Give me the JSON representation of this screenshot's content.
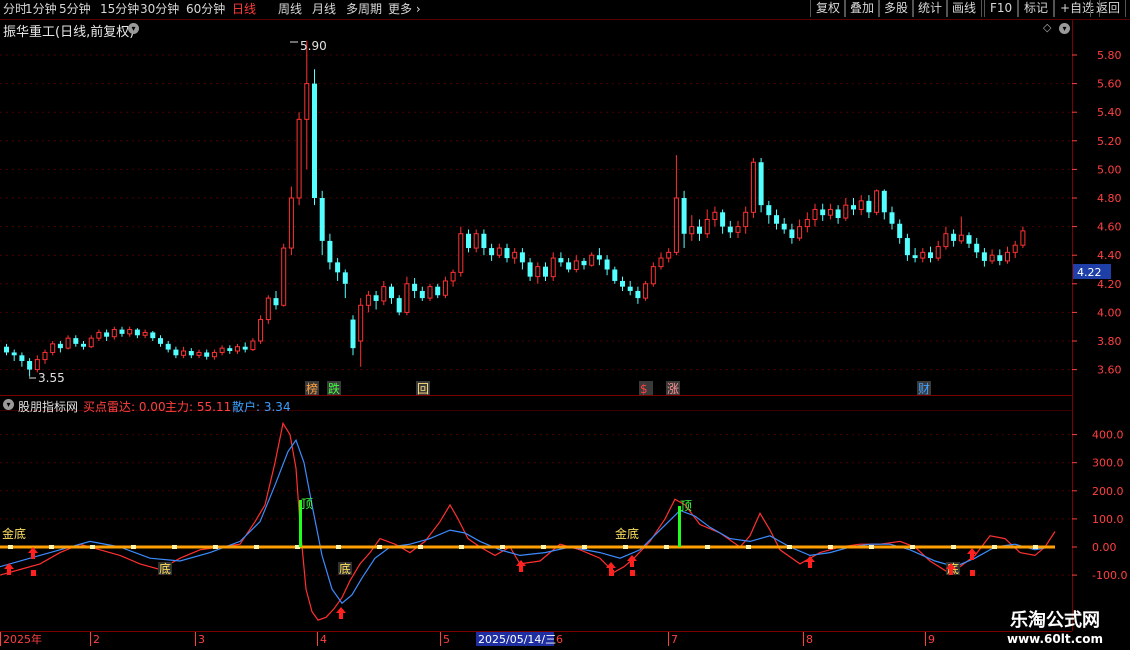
{
  "toolbar": {
    "periods": [
      "分时",
      "1分钟",
      "5分钟",
      "15分钟",
      "30分钟",
      "60分钟",
      "日线",
      "周线",
      "月线",
      "多周期",
      "更多"
    ],
    "active_period": "日线",
    "actions": [
      "复权",
      "叠加",
      "多股",
      "统计",
      "画线",
      "F10",
      "标记",
      "+自选",
      "返回"
    ]
  },
  "stock": {
    "title": "振华重工(日线,前复权)"
  },
  "indicator": {
    "name": "股朋指标网",
    "lines": [
      {
        "label": "买点雷达: 0.00",
        "color": "#ff4040"
      },
      {
        "label": "主力: 55.11",
        "color": "#ff4040"
      },
      {
        "label": "散户: 3.34",
        "color": "#3ca0ff"
      }
    ]
  },
  "price_axis": {
    "ticks": [
      "5.80",
      "5.60",
      "5.40",
      "5.20",
      "5.00",
      "4.80",
      "4.60",
      "4.40",
      "4.20",
      "4.00",
      "3.80",
      "3.60"
    ],
    "current": "4.22"
  },
  "ind_axis": {
    "ticks": [
      "400.0",
      "300.0",
      "200.0",
      "100.0",
      "0.00",
      "-100.0"
    ]
  },
  "annotations": {
    "high": "5.90",
    "low": "3.55",
    "events": [
      "榜",
      "跌",
      "回",
      "$",
      "涨",
      "财"
    ]
  },
  "ind_labels": {
    "jin_di": "金底",
    "di": "底",
    "ding": "顶"
  },
  "time_axis": {
    "labels": [
      "2025年",
      "2",
      "3",
      "4",
      "5",
      "6",
      "7",
      "8",
      "9"
    ],
    "cursor": "2025/05/14/三"
  },
  "watermark": {
    "title": "乐淘公式网",
    "url": "www.60lt.com"
  },
  "chart_data": {
    "type": "candlestick",
    "title": "振华重工(日线,前复权)",
    "ylim": [
      3.5,
      5.95
    ],
    "high_label": 5.9,
    "low_label": 3.55,
    "last_close": 4.22,
    "candles": [
      [
        3.76,
        3.72,
        3.78,
        3.7
      ],
      [
        3.72,
        3.7,
        3.74,
        3.66
      ],
      [
        3.7,
        3.66,
        3.72,
        3.62
      ],
      [
        3.66,
        3.6,
        3.68,
        3.55
      ],
      [
        3.6,
        3.67,
        3.7,
        3.58
      ],
      [
        3.67,
        3.72,
        3.74,
        3.64
      ],
      [
        3.72,
        3.78,
        3.8,
        3.7
      ],
      [
        3.78,
        3.75,
        3.8,
        3.72
      ],
      [
        3.75,
        3.82,
        3.84,
        3.74
      ],
      [
        3.82,
        3.78,
        3.84,
        3.76
      ],
      [
        3.78,
        3.76,
        3.8,
        3.74
      ],
      [
        3.76,
        3.82,
        3.84,
        3.75
      ],
      [
        3.82,
        3.86,
        3.88,
        3.8
      ],
      [
        3.86,
        3.83,
        3.88,
        3.8
      ],
      [
        3.83,
        3.88,
        3.9,
        3.81
      ],
      [
        3.88,
        3.85,
        3.9,
        3.83
      ],
      [
        3.85,
        3.88,
        3.9,
        3.83
      ],
      [
        3.88,
        3.84,
        3.89,
        3.82
      ],
      [
        3.84,
        3.86,
        3.88,
        3.82
      ],
      [
        3.86,
        3.82,
        3.87,
        3.8
      ],
      [
        3.82,
        3.78,
        3.84,
        3.76
      ],
      [
        3.78,
        3.74,
        3.8,
        3.72
      ],
      [
        3.74,
        3.7,
        3.76,
        3.68
      ],
      [
        3.7,
        3.73,
        3.76,
        3.68
      ],
      [
        3.73,
        3.7,
        3.75,
        3.68
      ],
      [
        3.7,
        3.72,
        3.74,
        3.68
      ],
      [
        3.72,
        3.69,
        3.74,
        3.67
      ],
      [
        3.69,
        3.72,
        3.74,
        3.67
      ],
      [
        3.72,
        3.75,
        3.77,
        3.7
      ],
      [
        3.75,
        3.73,
        3.77,
        3.71
      ],
      [
        3.73,
        3.76,
        3.78,
        3.71
      ],
      [
        3.76,
        3.74,
        3.79,
        3.72
      ],
      [
        3.74,
        3.8,
        3.82,
        3.73
      ],
      [
        3.8,
        3.95,
        3.98,
        3.78
      ],
      [
        3.95,
        4.1,
        4.12,
        3.92
      ],
      [
        4.1,
        4.05,
        4.15,
        4.02
      ],
      [
        4.05,
        4.45,
        4.48,
        4.04
      ],
      [
        4.45,
        4.8,
        4.88,
        4.4
      ],
      [
        4.8,
        5.35,
        5.4,
        4.75
      ],
      [
        5.35,
        5.6,
        5.9,
        5.0
      ],
      [
        5.6,
        4.8,
        5.7,
        4.75
      ],
      [
        4.8,
        4.5,
        4.85,
        4.4
      ],
      [
        4.5,
        4.35,
        4.55,
        4.3
      ],
      [
        4.35,
        4.28,
        4.38,
        4.22
      ],
      [
        4.28,
        4.2,
        4.3,
        4.1
      ],
      [
        3.95,
        3.75,
        3.98,
        3.7
      ],
      [
        3.8,
        4.05,
        4.1,
        3.62
      ],
      [
        4.05,
        4.12,
        4.15,
        4.0
      ],
      [
        4.12,
        4.08,
        4.15,
        4.02
      ],
      [
        4.08,
        4.18,
        4.22,
        4.05
      ],
      [
        4.18,
        4.1,
        4.2,
        4.06
      ],
      [
        4.1,
        4.0,
        4.12,
        3.98
      ],
      [
        4.0,
        4.2,
        4.25,
        3.98
      ],
      [
        4.2,
        4.15,
        4.24,
        4.1
      ],
      [
        4.15,
        4.1,
        4.18,
        4.08
      ],
      [
        4.1,
        4.18,
        4.2,
        4.08
      ],
      [
        4.18,
        4.12,
        4.2,
        4.1
      ],
      [
        4.12,
        4.22,
        4.25,
        4.1
      ],
      [
        4.22,
        4.28,
        4.3,
        4.18
      ],
      [
        4.28,
        4.55,
        4.6,
        4.25
      ],
      [
        4.55,
        4.45,
        4.58,
        4.42
      ],
      [
        4.45,
        4.55,
        4.58,
        4.42
      ],
      [
        4.55,
        4.45,
        4.58,
        4.4
      ],
      [
        4.45,
        4.4,
        4.48,
        4.36
      ],
      [
        4.4,
        4.45,
        4.48,
        4.38
      ],
      [
        4.45,
        4.38,
        4.48,
        4.35
      ],
      [
        4.38,
        4.42,
        4.45,
        4.34
      ],
      [
        4.42,
        4.35,
        4.45,
        4.3
      ],
      [
        4.35,
        4.25,
        4.38,
        4.22
      ],
      [
        4.25,
        4.32,
        4.35,
        4.2
      ],
      [
        4.32,
        4.25,
        4.35,
        4.22
      ],
      [
        4.25,
        4.38,
        4.42,
        4.22
      ],
      [
        4.38,
        4.35,
        4.42,
        4.32
      ],
      [
        4.35,
        4.3,
        4.38,
        4.28
      ],
      [
        4.3,
        4.36,
        4.4,
        4.28
      ],
      [
        4.36,
        4.33,
        4.38,
        4.3
      ],
      [
        4.33,
        4.4,
        4.42,
        4.32
      ],
      [
        4.4,
        4.37,
        4.45,
        4.33
      ],
      [
        4.37,
        4.3,
        4.4,
        4.26
      ],
      [
        4.3,
        4.22,
        4.32,
        4.2
      ],
      [
        4.22,
        4.18,
        4.25,
        4.15
      ],
      [
        4.18,
        4.15,
        4.22,
        4.12
      ],
      [
        4.15,
        4.1,
        4.18,
        4.06
      ],
      [
        4.1,
        4.2,
        4.22,
        4.08
      ],
      [
        4.2,
        4.32,
        4.35,
        4.18
      ],
      [
        4.32,
        4.38,
        4.42,
        4.3
      ],
      [
        4.38,
        4.42,
        4.45,
        4.35
      ],
      [
        4.42,
        4.8,
        5.1,
        4.4
      ],
      [
        4.8,
        4.55,
        4.85,
        4.45
      ],
      [
        4.55,
        4.6,
        4.68,
        4.5
      ],
      [
        4.6,
        4.55,
        4.65,
        4.5
      ],
      [
        4.55,
        4.65,
        4.72,
        4.52
      ],
      [
        4.65,
        4.7,
        4.74,
        4.6
      ],
      [
        4.7,
        4.6,
        4.72,
        4.55
      ],
      [
        4.6,
        4.56,
        4.64,
        4.52
      ],
      [
        4.56,
        4.6,
        4.64,
        4.52
      ],
      [
        4.6,
        4.7,
        4.74,
        4.55
      ],
      [
        4.7,
        5.05,
        5.08,
        4.66
      ],
      [
        5.05,
        4.75,
        5.08,
        4.7
      ],
      [
        4.75,
        4.68,
        4.78,
        4.62
      ],
      [
        4.68,
        4.62,
        4.72,
        4.58
      ],
      [
        4.62,
        4.58,
        4.66,
        4.55
      ],
      [
        4.58,
        4.52,
        4.62,
        4.48
      ],
      [
        4.52,
        4.6,
        4.65,
        4.5
      ],
      [
        4.6,
        4.65,
        4.7,
        4.56
      ],
      [
        4.65,
        4.72,
        4.76,
        4.6
      ],
      [
        4.72,
        4.68,
        4.76,
        4.64
      ],
      [
        4.68,
        4.72,
        4.76,
        4.65
      ],
      [
        4.72,
        4.66,
        4.75,
        4.62
      ],
      [
        4.66,
        4.75,
        4.8,
        4.64
      ],
      [
        4.75,
        4.72,
        4.8,
        4.68
      ],
      [
        4.72,
        4.78,
        4.82,
        4.68
      ],
      [
        4.78,
        4.7,
        4.82,
        4.66
      ],
      [
        4.7,
        4.85,
        4.86,
        4.68
      ],
      [
        4.85,
        4.7,
        4.86,
        4.65
      ],
      [
        4.7,
        4.62,
        4.74,
        4.58
      ],
      [
        4.62,
        4.52,
        4.65,
        4.48
      ],
      [
        4.52,
        4.4,
        4.55,
        4.36
      ],
      [
        4.4,
        4.38,
        4.45,
        4.35
      ],
      [
        4.38,
        4.42,
        4.45,
        4.35
      ],
      [
        4.42,
        4.38,
        4.46,
        4.35
      ],
      [
        4.38,
        4.46,
        4.5,
        4.36
      ],
      [
        4.46,
        4.55,
        4.6,
        4.44
      ],
      [
        4.55,
        4.5,
        4.58,
        4.46
      ],
      [
        4.5,
        4.54,
        4.67,
        4.48
      ],
      [
        4.54,
        4.48,
        4.56,
        4.45
      ],
      [
        4.48,
        4.42,
        4.52,
        4.38
      ],
      [
        4.42,
        4.36,
        4.45,
        4.32
      ],
      [
        4.36,
        4.4,
        4.44,
        4.34
      ],
      [
        4.4,
        4.36,
        4.44,
        4.33
      ],
      [
        4.36,
        4.42,
        4.46,
        4.34
      ],
      [
        4.42,
        4.47,
        4.5,
        4.38
      ],
      [
        4.47,
        4.57,
        4.6,
        4.45
      ]
    ]
  }
}
